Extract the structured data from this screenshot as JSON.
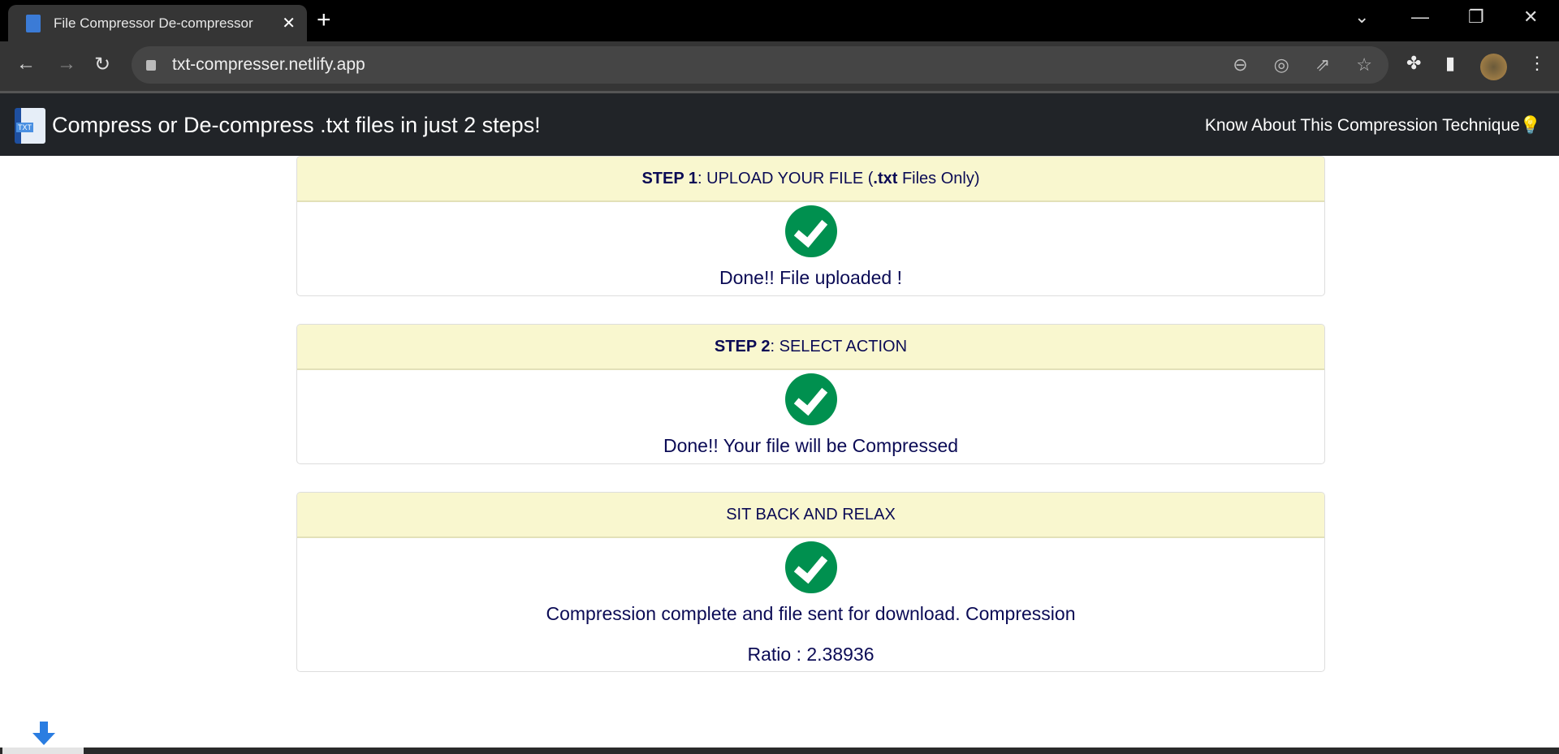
{
  "browser": {
    "tab_title": "File Compressor De-compressor",
    "url": "txt-compresser.netlify.app"
  },
  "app": {
    "brand": "Compress or De-compress .txt files in just 2 steps!",
    "know_link": "Know About This Compression Technique",
    "know_emoji": "💡"
  },
  "steps": [
    {
      "header_bold": "STEP 1",
      "header_rest": ": UPLOAD YOUR FILE (",
      "header_bold2": ".txt",
      "header_tail": " Files Only)",
      "message": "Done!! File uploaded !"
    },
    {
      "header_bold": "STEP 2",
      "header_rest": ": SELECT ACTION",
      "message": "Done!! Your file will be Compressed"
    },
    {
      "header": "SIT BACK AND RELAX",
      "message_line1": "Compression complete and file sent for download. Compression",
      "message_line2": "Ratio : 2.38936"
    }
  ],
  "colors": {
    "header_bg": "#f9f7cf",
    "check": "#00904f",
    "text": "#0b0b55",
    "navbar": "#212428"
  }
}
